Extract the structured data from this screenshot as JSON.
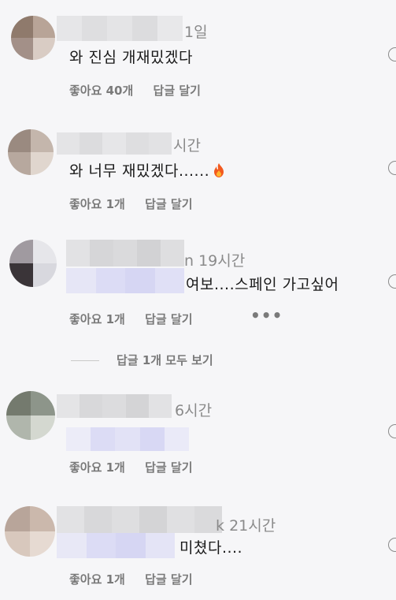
{
  "comments": [
    {
      "time": "1일",
      "text": "와 진심 개재밌겠다",
      "like_label": "좋아요 40개",
      "reply_label": "답글 달기"
    },
    {
      "time": "시간",
      "text": "와 너무 재밌겠다......",
      "emoji_icon": "fire-icon",
      "like_label": "좋아요 1개",
      "reply_label": "답글 달기"
    },
    {
      "time_prefix": "n",
      "time": "19시간",
      "text": "여보....스페인 가고싶어",
      "like_label": "좋아요 1개",
      "reply_label": "답글 달기",
      "more_label": "•••"
    },
    {
      "time": "6시간",
      "text": "",
      "like_label": "좋아요 1개",
      "reply_label": "답글 달기"
    },
    {
      "time_prefix": "k",
      "time": "21시간",
      "text": "미쳤다....",
      "like_label": "좋아요 1개",
      "reply_label": "답글 달기"
    }
  ],
  "view_replies_label": "답글 1개 모두 보기",
  "colors": {
    "background": "#f6f6f8",
    "muted_text": "#7a7a7a",
    "mention_blur": "#dcdcf5"
  }
}
